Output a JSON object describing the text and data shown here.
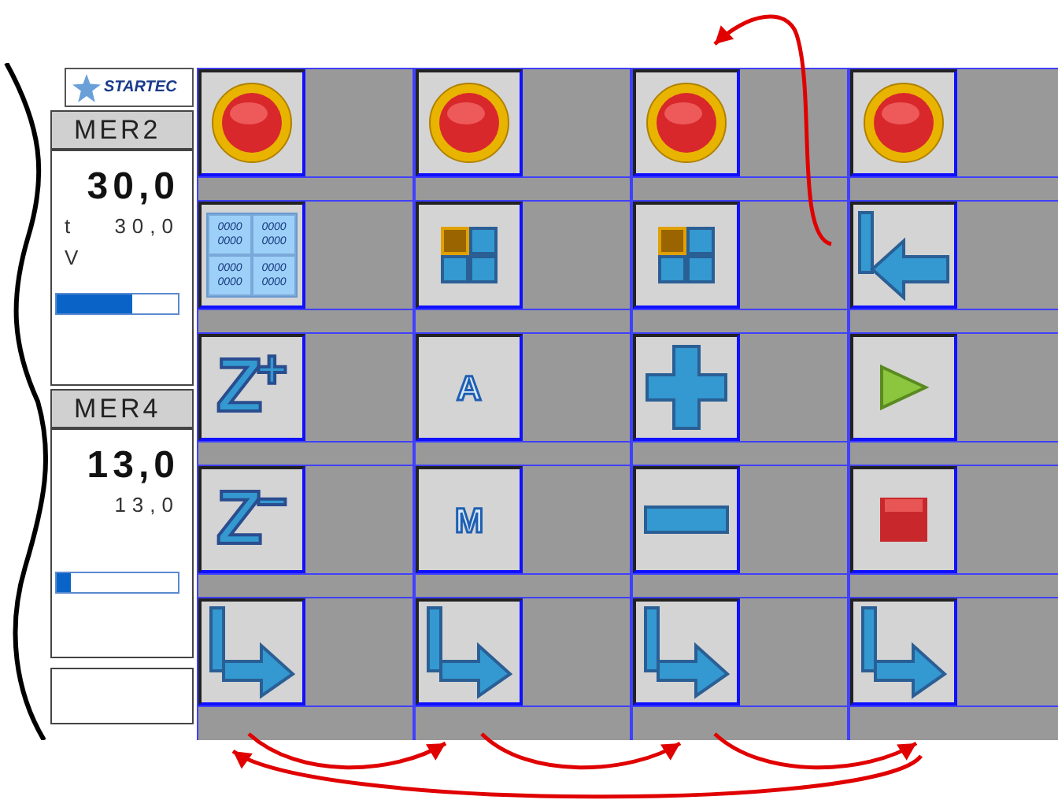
{
  "logo": {
    "text": "STARTEC"
  },
  "meters": [
    {
      "header": "MER2",
      "value": "30,0",
      "sub_label": "t",
      "sub_value": "30,0",
      "unit_label": "V",
      "level": 0.62
    },
    {
      "header": "MER4",
      "value": "13,0",
      "sub_value": "13,0",
      "level": 0.12
    }
  ],
  "grid": {
    "columns": [
      {
        "buttons": [
          {
            "kind": "stop"
          },
          {
            "kind": "memory",
            "cells": [
              "0000 0000",
              "0000 0000",
              "0000 0000",
              "0000 0000"
            ]
          },
          {
            "kind": "z",
            "label": "Z",
            "sign": "+"
          },
          {
            "kind": "z",
            "label": "Z",
            "sign": "−"
          },
          {
            "kind": "next"
          }
        ]
      },
      {
        "buttons": [
          {
            "kind": "stop"
          },
          {
            "kind": "quadrant"
          },
          {
            "kind": "letter",
            "label": "A"
          },
          {
            "kind": "letter",
            "label": "M"
          },
          {
            "kind": "next"
          }
        ]
      },
      {
        "buttons": [
          {
            "kind": "stop"
          },
          {
            "kind": "quadrant"
          },
          {
            "kind": "plus"
          },
          {
            "kind": "minus"
          },
          {
            "kind": "next"
          }
        ]
      },
      {
        "buttons": [
          {
            "kind": "stop"
          },
          {
            "kind": "back"
          },
          {
            "kind": "play"
          },
          {
            "kind": "halt"
          },
          {
            "kind": "next"
          }
        ]
      }
    ]
  }
}
